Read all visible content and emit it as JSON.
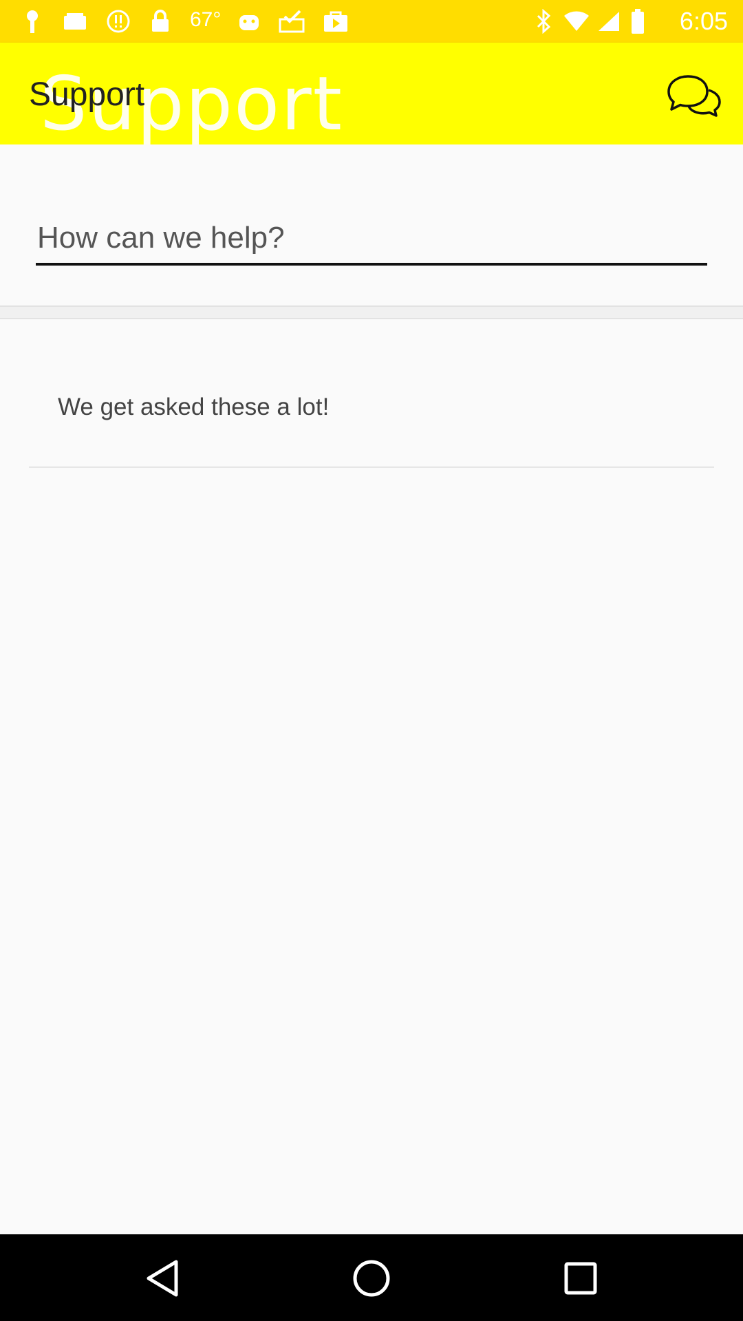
{
  "status_bar": {
    "temperature": "67°",
    "time": "6:05",
    "background_color": "#ffdd00",
    "icons": [
      "key-icon",
      "notification-icon",
      "alert-icon",
      "lock-icon",
      "android-icon",
      "inbox-check-icon",
      "play-store-icon",
      "bluetooth-icon",
      "wifi-icon",
      "signal-icon",
      "battery-icon"
    ]
  },
  "app_bar": {
    "title": "Support",
    "ghost_title": "Support",
    "chat_icon": "chat-bubbles-icon",
    "background_color": "#ffff00"
  },
  "search": {
    "placeholder": "How can we help?"
  },
  "faq": {
    "header": "We get asked these a lot!"
  },
  "nav_bar": {
    "back_icon": "back-triangle-icon",
    "home_icon": "home-circle-icon",
    "recents_icon": "recents-square-icon"
  }
}
